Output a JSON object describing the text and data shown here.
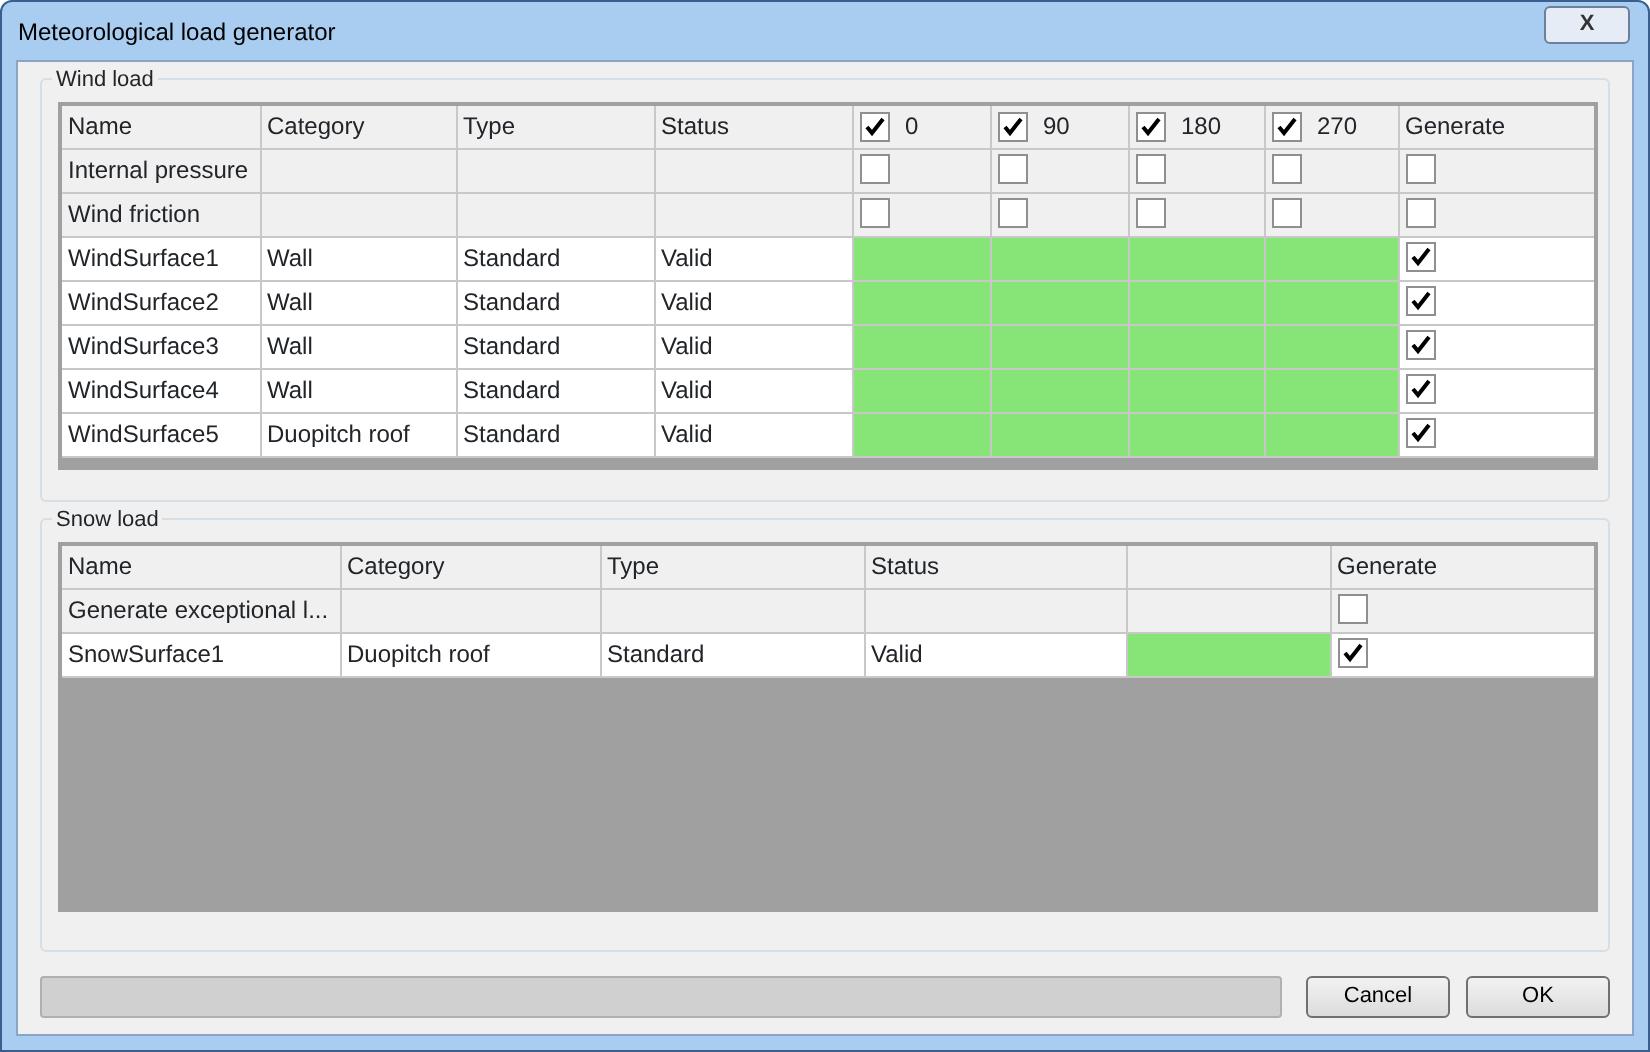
{
  "window": {
    "title": "Meteorological load generator",
    "close_label": "X"
  },
  "wind_load": {
    "title": "Wind load",
    "columns": [
      {
        "kind": "text",
        "label": "Name"
      },
      {
        "kind": "text",
        "label": "Category"
      },
      {
        "kind": "text",
        "label": "Type"
      },
      {
        "kind": "text",
        "label": "Status"
      },
      {
        "kind": "direction",
        "label": "0",
        "checked": true
      },
      {
        "kind": "direction",
        "label": "90",
        "checked": true
      },
      {
        "kind": "direction",
        "label": "180",
        "checked": true
      },
      {
        "kind": "direction",
        "label": "270",
        "checked": true
      },
      {
        "kind": "generate",
        "label": "Generate"
      }
    ],
    "rows": [
      {
        "kind": "option",
        "name": "Internal pressure",
        "directions": [
          false,
          false,
          false,
          false
        ],
        "generate": false
      },
      {
        "kind": "option",
        "name": "Wind friction",
        "directions": [
          false,
          false,
          false,
          false
        ],
        "generate": false
      },
      {
        "kind": "surface",
        "name": "WindSurface1",
        "category": "Wall",
        "type": "Standard",
        "status": "Valid",
        "generate": true
      },
      {
        "kind": "surface",
        "name": "WindSurface2",
        "category": "Wall",
        "type": "Standard",
        "status": "Valid",
        "generate": true
      },
      {
        "kind": "surface",
        "name": "WindSurface3",
        "category": "Wall",
        "type": "Standard",
        "status": "Valid",
        "generate": true
      },
      {
        "kind": "surface",
        "name": "WindSurface4",
        "category": "Wall",
        "type": "Standard",
        "status": "Valid",
        "generate": true
      },
      {
        "kind": "surface",
        "name": "WindSurface5",
        "category": "Duopitch roof",
        "type": "Standard",
        "status": "Valid",
        "generate": true
      }
    ]
  },
  "snow_load": {
    "title": "Snow load",
    "columns": [
      {
        "kind": "text",
        "label": "Name"
      },
      {
        "kind": "text",
        "label": "Category"
      },
      {
        "kind": "text",
        "label": "Type"
      },
      {
        "kind": "text",
        "label": "Status"
      },
      {
        "kind": "blank"
      },
      {
        "kind": "generate",
        "label": "Generate"
      }
    ],
    "rows": [
      {
        "kind": "option",
        "name": "Generate exceptional l...",
        "generate": false
      },
      {
        "kind": "surface",
        "name": "SnowSurface1",
        "category": "Duopitch roof",
        "type": "Standard",
        "status": "Valid",
        "generate": true
      }
    ]
  },
  "progress": {
    "level": 0
  },
  "buttons": [
    "Cancel",
    "OK"
  ]
}
